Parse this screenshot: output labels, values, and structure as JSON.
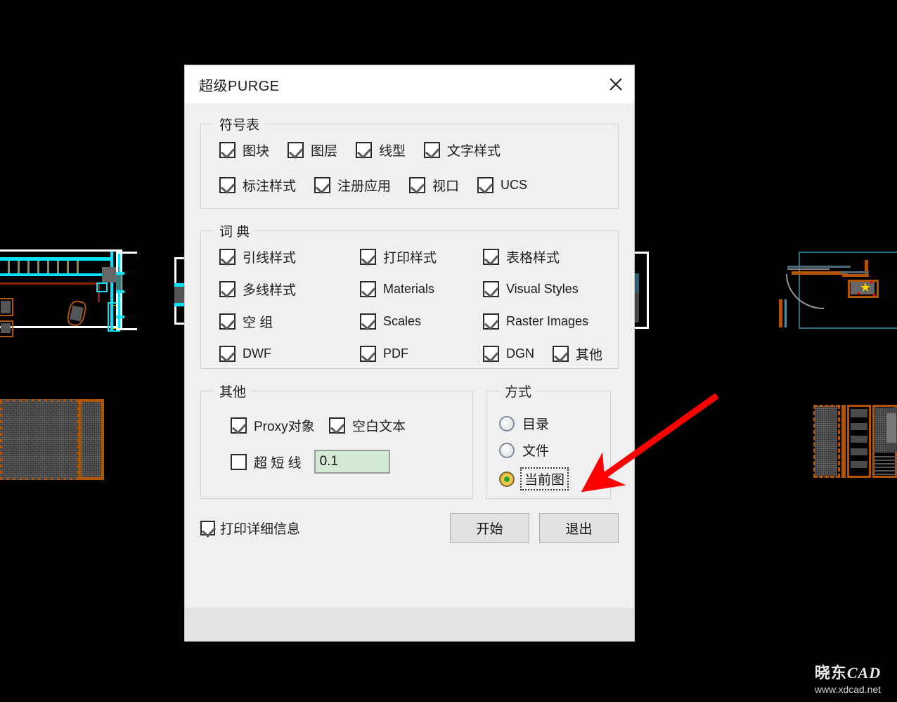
{
  "dialog": {
    "title": "超级PURGE",
    "close_icon": "close-icon",
    "groups": {
      "symbol_table": {
        "legend": "符号表",
        "row1": [
          {
            "label": "图块",
            "checked": true
          },
          {
            "label": "图层",
            "checked": true
          },
          {
            "label": "线型",
            "checked": true
          },
          {
            "label": "文字样式",
            "checked": true
          }
        ],
        "row2": [
          {
            "label": "标注样式",
            "checked": true
          },
          {
            "label": "注册应用",
            "checked": true
          },
          {
            "label": "视口",
            "checked": true
          },
          {
            "label": "UCS",
            "checked": true
          }
        ]
      },
      "dictionary": {
        "legend": "词 典",
        "items": [
          {
            "label": "引线样式",
            "checked": true
          },
          {
            "label": "打印样式",
            "checked": true
          },
          {
            "label": "表格样式",
            "checked": true
          },
          {
            "label": "多线样式",
            "checked": true
          },
          {
            "label": "Materials",
            "checked": true
          },
          {
            "label": "Visual Styles",
            "checked": true
          },
          {
            "label": "空 组",
            "checked": true
          },
          {
            "label": "Scales",
            "checked": true
          },
          {
            "label": "Raster Images",
            "checked": true
          },
          {
            "label": "DWF",
            "checked": true
          },
          {
            "label": "PDF",
            "checked": true
          },
          {
            "label": "DGN",
            "checked": true
          },
          {
            "label": "其他",
            "checked": true
          }
        ]
      },
      "other": {
        "legend": "其他",
        "proxy": {
          "label": "Proxy对象",
          "checked": true
        },
        "blank_text": {
          "label": "空白文本",
          "checked": true
        },
        "short_line": {
          "label": "超 短 线",
          "checked": false
        },
        "tolerance_value": "0.1"
      },
      "method": {
        "legend": "方式",
        "options": [
          {
            "label": "目录",
            "selected": false
          },
          {
            "label": "文件",
            "selected": false
          },
          {
            "label": "当前图",
            "selected": true
          }
        ]
      }
    },
    "print_detail": {
      "label": "打印详细信息",
      "checked": true
    },
    "buttons": {
      "start": "开始",
      "exit": "退出"
    }
  },
  "annotation": {
    "arrow_color": "#ff0000",
    "points_to": "当前图"
  },
  "watermark": {
    "logo_cn": "晓东",
    "logo_en": "CAD",
    "url": "www.xdcad.net"
  },
  "colors": {
    "dialog_bg": "#f0f0f0",
    "titlebar_bg": "#ffffff",
    "input_bg": "#d2e8d2",
    "canvas_bg": "#000000",
    "cad_cyan": "#00e5ff",
    "cad_orange": "#b35500",
    "cad_white": "#ffffff"
  }
}
